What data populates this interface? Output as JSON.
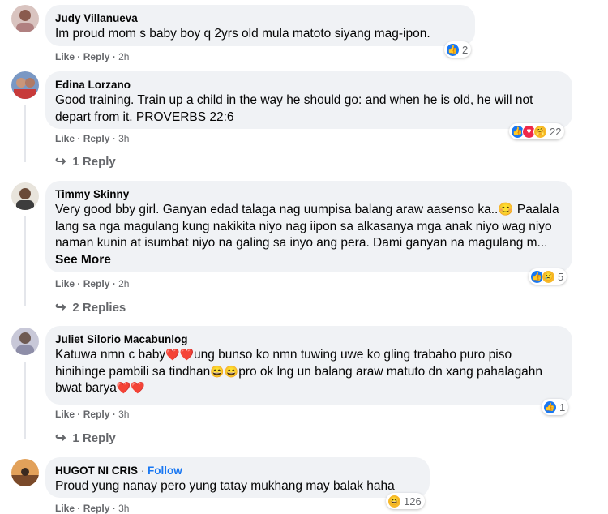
{
  "comments": [
    {
      "name": "Judy Villanueva",
      "text": "Im proud mom s baby boy q 2yrs old mula matoto siyang mag-ipon.",
      "like": "Like",
      "reply": "Reply",
      "time": "2h",
      "reaction_count": "2",
      "reactions": [
        "like-icon"
      ]
    },
    {
      "name": "Edina Lorzano",
      "text": "Good training. Train up a child in the way he should go: and when he is old, he will not depart from it. PROVERBS 22:6",
      "like": "Like",
      "reply": "Reply",
      "time": "3h",
      "reaction_count": "22",
      "reactions": [
        "like-icon",
        "love-icon",
        "care-icon"
      ],
      "replies_label": "1 Reply"
    },
    {
      "name": "Timmy Skinny",
      "text": "Very good bby girl. Ganyan edad talaga nag uumpisa balang araw aasenso ka..😊 Paalala lang sa nga magulang kung nakikita niyo nag iipon sa alkasanya mga anak niyo wag niyo naman kunin at isumbat niyo na galing sa inyo ang pera. Dami ganyan na magulang m...",
      "see_more": "See More",
      "like": "Like",
      "reply": "Reply",
      "time": "2h",
      "reaction_count": "5",
      "reactions": [
        "like-icon",
        "sad-icon"
      ],
      "replies_label": "2 Replies"
    },
    {
      "name": "Juliet Silorio Macabunlog",
      "text_parts": [
        "Katuwa nmn c baby",
        "❤️❤️",
        "ung bunso ko nmn tuwing uwe ko gling trabaho puro piso hinihinge pambili sa tindhan",
        "😄😄",
        "pro ok lng un balang araw matuto dn xang pahalagahn bwat barya",
        "❤️❤️"
      ],
      "like": "Like",
      "reply": "Reply",
      "time": "3h",
      "reaction_count": "1",
      "reactions": [
        "like-icon"
      ],
      "replies_label": "1 Reply"
    },
    {
      "name": "HUGOT NI CRIS",
      "separator": "·",
      "follow": "Follow",
      "text": "Proud yung nanay pero yung tatay mukhang may balak haha",
      "like": "Like",
      "reply": "Reply",
      "time": "3h",
      "reaction_count": "126",
      "reactions": [
        "haha-icon"
      ]
    }
  ],
  "meta_separator": "·",
  "colors": {
    "bubble": "#f0f2f5",
    "link": "#1877f2",
    "muted": "#65676b",
    "like": "#1877f2",
    "love": "#f02849",
    "haha": "#f7b928"
  }
}
